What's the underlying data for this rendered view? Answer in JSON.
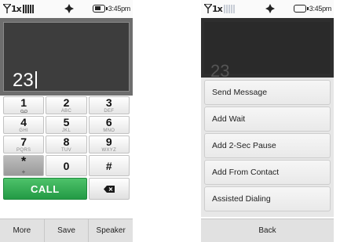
{
  "left_screen": {
    "status_bar": {
      "network": "1x",
      "time": "3:45pm"
    },
    "display": {
      "number": "23"
    },
    "keypad": {
      "keys": [
        {
          "digit": "1",
          "letters": ""
        },
        {
          "digit": "2",
          "letters": "ABC"
        },
        {
          "digit": "3",
          "letters": "DEF"
        },
        {
          "digit": "4",
          "letters": "GHI"
        },
        {
          "digit": "5",
          "letters": "JKL"
        },
        {
          "digit": "6",
          "letters": "MNO"
        },
        {
          "digit": "7",
          "letters": "PQRS"
        },
        {
          "digit": "8",
          "letters": "TUV"
        },
        {
          "digit": "9",
          "letters": "WXYZ"
        },
        {
          "digit": "*",
          "letters": "+"
        },
        {
          "digit": "0",
          "letters": ""
        },
        {
          "digit": "#",
          "letters": ""
        }
      ],
      "call_label": "CALL"
    },
    "bottom_bar": {
      "more": "More",
      "save": "Save",
      "speaker": "Speaker"
    }
  },
  "right_screen": {
    "status_bar": {
      "network": "1x",
      "time": "3:45pm"
    },
    "display": {
      "number": "23"
    },
    "menu": {
      "items": [
        "Send Message",
        "Add Wait",
        "Add 2-Sec Pause",
        "Add From Contact",
        "Assisted Dialing"
      ]
    },
    "back_label": "Back"
  }
}
